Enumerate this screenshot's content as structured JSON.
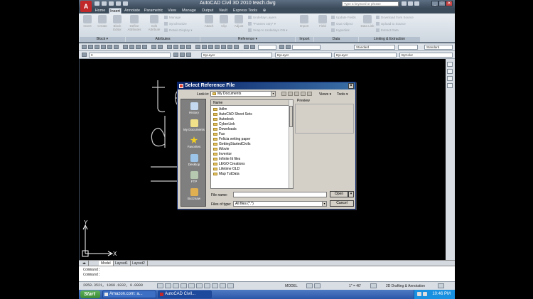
{
  "window": {
    "title": "AutoCAD Civil 3D 2010   teach.dwg",
    "search_placeholder": "Type a keyword or phrase",
    "minimize": "_",
    "maximize": "□",
    "close": "✕"
  },
  "ribbon": {
    "tabs": [
      "Home",
      "Insert",
      "Annotate",
      "Parametric",
      "View",
      "Manage",
      "Output",
      "Vault",
      "Express Tools",
      "⊕"
    ],
    "active_tab": "Insert",
    "groups": [
      {
        "label": "Block ▾",
        "big": [
          "Insert",
          "Create",
          "Block Editor"
        ]
      },
      {
        "label": "Attributes",
        "big": [
          "Define Attributes",
          "Edit Attribute"
        ],
        "small": [
          "Manage",
          "Synchronize",
          "Retain Display ▾"
        ]
      },
      {
        "label": "Reference ▾",
        "big": [
          "Attach",
          "Clip",
          "Adjust"
        ],
        "small": [
          "Underlay Layers",
          "*Frames vary* ▾",
          "Snap to Underlays ON ▾"
        ]
      },
      {
        "label": "Import",
        "big": [
          "Import"
        ]
      },
      {
        "label": "Data",
        "big": [
          "Field"
        ],
        "small": [
          "Update Fields",
          "OLE Object",
          "Hyperlink"
        ]
      },
      {
        "label": "Linking & Extraction",
        "big": [
          "Data Link"
        ],
        "small": [
          "Download from Source",
          "Upload to Source",
          "Extract Data"
        ]
      }
    ]
  },
  "toolbars": {
    "layer_combo": "0",
    "style_combo": "Standard",
    "style_combo2": "Standard",
    "bylayer1": "ByLayer",
    "bylayer2": "ByLayer",
    "bylayer3": "ByLayer",
    "bycolor": "ByColor"
  },
  "layout_tabs": [
    "Model",
    "Layout1",
    "Layout2"
  ],
  "active_layout": "Model",
  "command_line": [
    "Command:",
    "Command:"
  ],
  "status": {
    "coordinates": "2050.3521, 1060.1832, 0.0000",
    "model_label": "MODEL",
    "scale": "1\" = 40'",
    "workspace": "2D Drafting & Annotation"
  },
  "taskbar": {
    "start": "Start",
    "items": [
      "Amazon.com: a...",
      "AutoCAD Civil..."
    ],
    "clock": "10:46 PM"
  },
  "dialog": {
    "title": "Select Reference File",
    "look_in_label": "Look in:",
    "look_in_value": "My Documents",
    "views_label": "Views ▾",
    "tools_label": "Tools ▾",
    "preview_label": "Preview",
    "list_header": "Name",
    "places": [
      "History",
      "My Documents",
      "Favorites",
      "Desktop",
      "FTP",
      "Buzzsaw"
    ],
    "files": [
      "Adlm",
      "AutoCAD Sheet Sets",
      "Autodesk",
      "CyberLink",
      "Downloads",
      "Fax",
      "Felicia writing paper",
      "GettingStartedCiviIs",
      "iMovie",
      "Inventor",
      "Infinite Iit files",
      "LEGO Creations",
      "Lifetime OLD",
      "Map TutData"
    ],
    "file_name_label": "File name:",
    "file_name_value": "",
    "file_type_label": "Files of type:",
    "file_type_value": "All files (*.*)",
    "open_button": "Open",
    "cancel_button": "Cancel"
  }
}
